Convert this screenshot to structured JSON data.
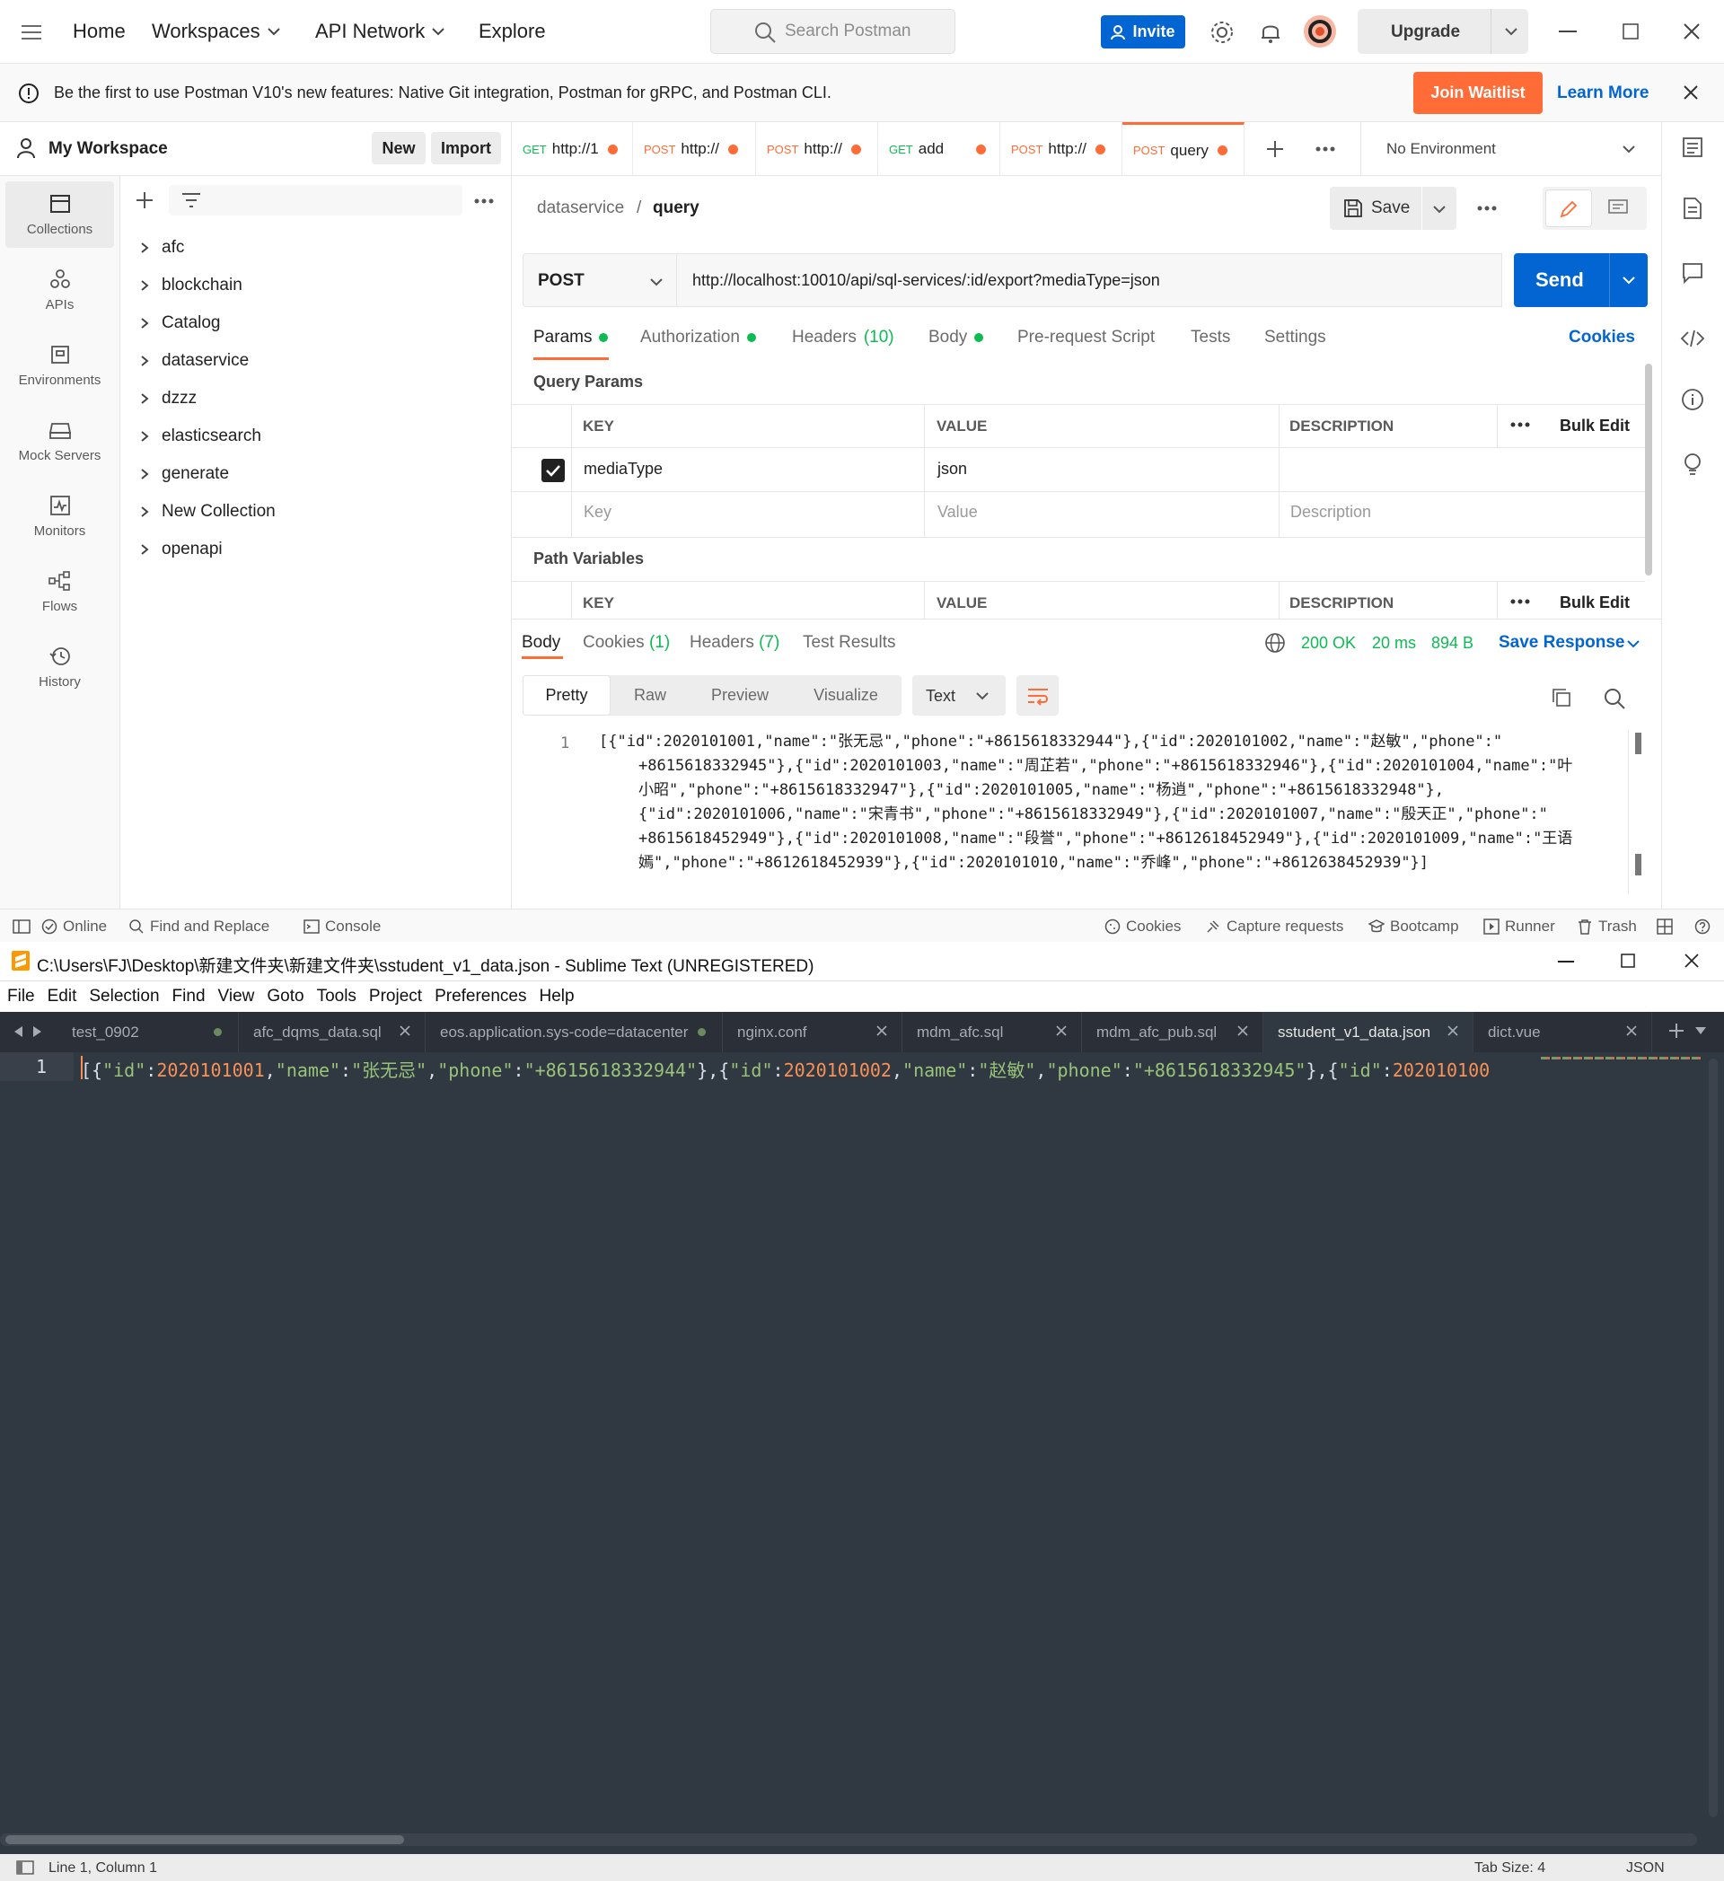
{
  "postman": {
    "nav": {
      "home": "Home",
      "workspaces": "Workspaces",
      "api_network": "API Network",
      "explore": "Explore"
    },
    "search_placeholder": "Search Postman",
    "invite": "Invite",
    "upgrade": "Upgrade",
    "banner": {
      "text": "Be the first to use Postman V10's new features: Native Git integration, Postman for gRPC, and Postman CLI.",
      "join": "Join Waitlist",
      "learn_more": "Learn More"
    },
    "workspace": {
      "name": "My Workspace",
      "new": "New",
      "import": "Import"
    },
    "rail": [
      "Collections",
      "APIs",
      "Environments",
      "Mock Servers",
      "Monitors",
      "Flows",
      "History"
    ],
    "collections": [
      "afc",
      "blockchain",
      "Catalog",
      "dataservice",
      "dzzz",
      "elasticsearch",
      "generate",
      "New Collection",
      "openapi"
    ],
    "tabs": [
      {
        "method": "GET",
        "label": "http://1"
      },
      {
        "method": "POST",
        "label": "http://"
      },
      {
        "method": "POST",
        "label": "http://"
      },
      {
        "method": "GET",
        "label": "add"
      },
      {
        "method": "POST",
        "label": "http://"
      },
      {
        "method": "POST",
        "label": "query"
      }
    ],
    "environment": "No Environment",
    "breadcrumb": {
      "parent": "dataservice",
      "sep": "/",
      "current": "query"
    },
    "save": "Save",
    "request": {
      "method": "POST",
      "url": "http://localhost:10010/api/sql-services/:id/export?mediaType=json",
      "send": "Send"
    },
    "req_tabs": {
      "params": "Params",
      "authorization": "Authorization",
      "headers": "Headers",
      "headers_count": "(10)",
      "body": "Body",
      "prerequest": "Pre-request Script",
      "tests": "Tests",
      "settings": "Settings",
      "cookies": "Cookies"
    },
    "query_params": {
      "title": "Query Params",
      "headers": [
        "KEY",
        "VALUE",
        "DESCRIPTION"
      ],
      "bulk_edit": "Bulk Edit",
      "rows": [
        {
          "key": "mediaType",
          "value": "json",
          "checked": true
        }
      ],
      "placeholder": {
        "key": "Key",
        "value": "Value",
        "description": "Description"
      }
    },
    "path_variables": {
      "title": "Path Variables",
      "headers": [
        "KEY",
        "VALUE",
        "DESCRIPTION"
      ],
      "bulk_edit": "Bulk Edit"
    },
    "response": {
      "tabs": {
        "body": "Body",
        "cookies": "Cookies",
        "cookies_count": "(1)",
        "headers": "Headers",
        "headers_count": "(7)",
        "tests": "Test Results"
      },
      "status": "200 OK",
      "time": "20 ms",
      "size": "894 B",
      "save": "Save Response",
      "modes": [
        "Pretty",
        "Raw",
        "Preview",
        "Visualize"
      ],
      "format": "Text",
      "line_no": "1",
      "body_lines": [
        "[{\"id\":2020101001,\"name\":\"张无忌\",\"phone\":\"+8615618332944\"},{\"id\":2020101002,\"name\":\"赵敏\",\"phone\":\"",
        "+8615618332945\"},{\"id\":2020101003,\"name\":\"周芷若\",\"phone\":\"+8615618332946\"},{\"id\":2020101004,\"name\":\"叶",
        "小昭\",\"phone\":\"+8615618332947\"},{\"id\":2020101005,\"name\":\"杨逍\",\"phone\":\"+8615618332948\"},",
        "{\"id\":2020101006,\"name\":\"宋青书\",\"phone\":\"+8615618332949\"},{\"id\":2020101007,\"name\":\"殷天正\",\"phone\":\"",
        "+8615618452949\"},{\"id\":2020101008,\"name\":\"段誉\",\"phone\":\"+8612618452949\"},{\"id\":2020101009,\"name\":\"王语",
        "嫣\",\"phone\":\"+8612618452939\"},{\"id\":2020101010,\"name\":\"乔峰\",\"phone\":\"+8612638452939\"}]"
      ]
    },
    "statusbar": {
      "online": "Online",
      "find": "Find and Replace",
      "console": "Console",
      "cookies": "Cookies",
      "capture": "Capture requests",
      "bootcamp": "Bootcamp",
      "runner": "Runner",
      "trash": "Trash"
    },
    "colors": {
      "orange": "#ff6c37",
      "blue": "#0265d2",
      "green": "#0cbb52"
    }
  },
  "sublime": {
    "title": "C:\\Users\\FJ\\Desktop\\新建文件夹\\新建文件夹\\sstudent_v1_data.json - Sublime Text (UNREGISTERED)",
    "menu": [
      "File",
      "Edit",
      "Selection",
      "Find",
      "View",
      "Goto",
      "Tools",
      "Project",
      "Preferences",
      "Help"
    ],
    "tabs": [
      "test_0902",
      "afc_dqms_data.sql",
      "eos.application.sys-code=datacenter",
      "nginx.conf",
      "mdm_afc.sql",
      "mdm_afc_pub.sql",
      "sstudent_v1_data.json",
      "dict.vue"
    ],
    "line_no": "1",
    "line": {
      "a": "[{",
      "k1": "\"id\"",
      "c1": ":",
      "v1": "2020101001",
      "s1": ",",
      "k2": "\"name\"",
      "c2": ":",
      "v2": "\"张无忌\"",
      "s2": ",",
      "k3": "\"phone\"",
      "c3": ":",
      "v3": "\"+8615618332944\"",
      "s3": "},{",
      "k4": "\"id\"",
      "c4": ":",
      "v4": "2020101002",
      "s4": ",",
      "k5": "\"name\"",
      "c5": ":",
      "v5": "\"赵敏\"",
      "s5": ",",
      "k6": "\"phone\"",
      "c6": ":",
      "v6": "\"+8615618332945\"",
      "s6": "},{",
      "k7": "\"id\"",
      "c7": ":",
      "v7": "202010100"
    },
    "status": {
      "position": "Line 1, Column 1",
      "tab_size": "Tab Size: 4",
      "syntax": "JSON"
    }
  }
}
